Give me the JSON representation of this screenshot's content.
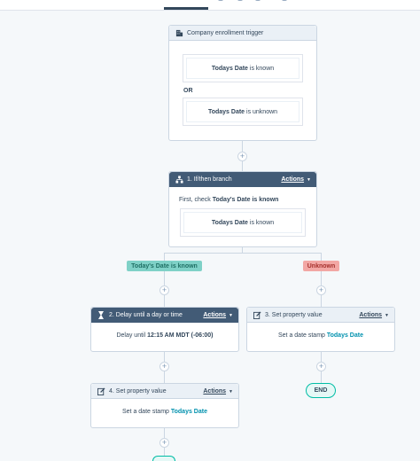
{
  "trigger": {
    "title": "Company enrollment trigger",
    "icon": "building-icon",
    "filter1": {
      "property": "Todays Date",
      "operator": "is known"
    },
    "or_label": "OR",
    "filter2": {
      "property": "Todays Date",
      "operator": "is unknown"
    }
  },
  "branch": {
    "title": "1. If/then branch",
    "actions_label": "Actions",
    "icon": "branch-icon",
    "first_check_prefix": "First, check",
    "first_check_property": "Today's Date is known",
    "filter": {
      "property": "Todays Date",
      "operator": "is known"
    },
    "left_label": "Today's Date is known",
    "right_label": "Unknown"
  },
  "delay": {
    "title": "2. Delay until a day or time",
    "actions_label": "Actions",
    "icon": "hourglass-icon",
    "body_prefix": "Delay until",
    "body_value": "12:15 AM MDT (-06:00)"
  },
  "set_property_right": {
    "title": "3. Set property value",
    "actions_label": "Actions",
    "icon": "edit-icon",
    "body_prefix": "Set a date stamp",
    "body_value": "Todays Date"
  },
  "set_property_left": {
    "title": "4. Set property value",
    "actions_label": "Actions",
    "icon": "edit-icon",
    "body_prefix": "Set a date stamp",
    "body_value": "Todays Date"
  },
  "end_label": "END",
  "plus_symbol": "+",
  "colors": {
    "dark_header": "#425b76",
    "light_header": "#eaf0f6",
    "green_badge": "#7fd1c7",
    "red_badge": "#f2a7a4",
    "teal": "#0091ae"
  }
}
